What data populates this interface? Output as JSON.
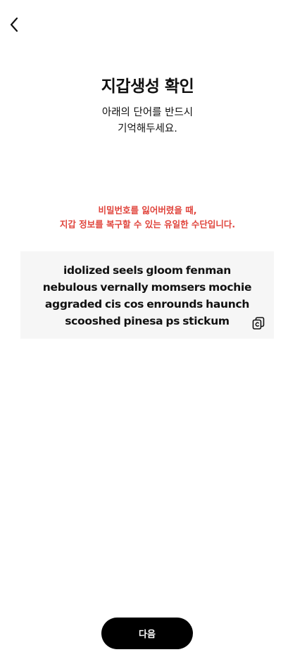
{
  "header": {
    "back_icon": "chevron-left-icon"
  },
  "title": "지갑생성 확인",
  "subtitle": {
    "line1": "아래의 단어를 반드시",
    "line2": "기억해두세요."
  },
  "warning": {
    "line1": "비밀번호를 잃어버렸을 때,",
    "line2": "지갑 정보를 복구할 수 있는 유일한 수단입니다.",
    "color": "#e0453d"
  },
  "mnemonic": {
    "text": "idolized seels gloom fenman nebulous vernally momsers mochie aggraded cis cos enrounds haunch scooshed pinesa ps stickum",
    "copy_icon": "copy-icon"
  },
  "footer": {
    "next_label": "다음"
  }
}
